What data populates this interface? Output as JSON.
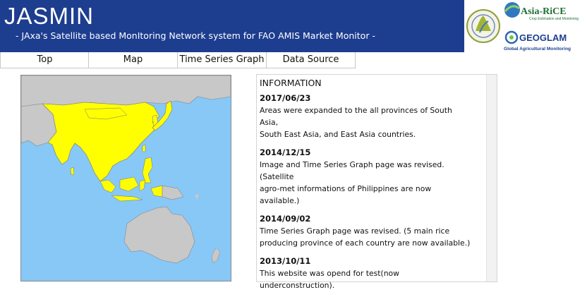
{
  "header": {
    "title": "JASMIN",
    "subtitle": "- JAxa's Satellite based MonItoring Network system for FAO AMIS Market Monitor -",
    "colors": {
      "banner": "#1d3d8f",
      "text": "#ffffff"
    }
  },
  "logos": {
    "asia_rice": {
      "name": "Asia-RiCE",
      "tagline": "Crop Estimation and Monitoring"
    },
    "geoglam": {
      "name": "GEOGLAM",
      "tagline": "Global Agricultural Monitoring"
    }
  },
  "nav": {
    "tabs": [
      {
        "label": "Top"
      },
      {
        "label": "Map"
      },
      {
        "label": "Time Series Graph"
      },
      {
        "label": "Data Source"
      }
    ]
  },
  "map": {
    "colors": {
      "ocean": "#87c8f7",
      "land": "#c8c8c8",
      "monitored": "#ffff00",
      "border": "#777777"
    }
  },
  "info": {
    "heading": "INFORMATION",
    "items": [
      {
        "date": "2017/06/23",
        "lines": [
          "Areas were expanded to the all provinces of South Asia,",
          "South East Asia, and East Asia countries."
        ]
      },
      {
        "date": "2014/12/15",
        "lines": [
          "Image and Time Series Graph page was revised. (Satellite",
          "agro-met informations of Philippines are now available.)"
        ]
      },
      {
        "date": "2014/09/02",
        "lines": [
          "Time Series Graph page was revised. (5 main rice",
          "producing province of each country are now available.)"
        ]
      },
      {
        "date": "2013/10/11",
        "lines": [
          "This website was opend for test(now underconstruction)."
        ]
      }
    ]
  }
}
